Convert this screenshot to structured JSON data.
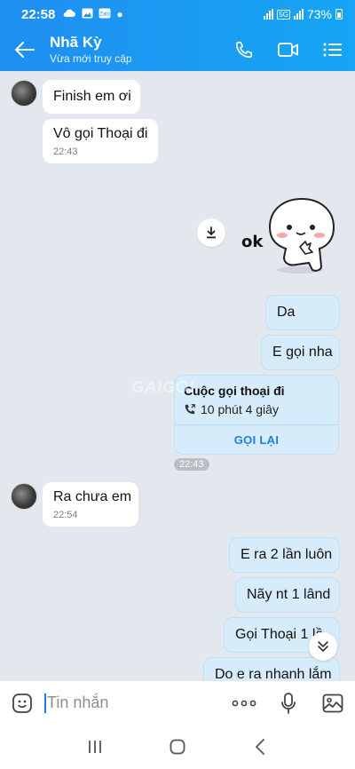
{
  "status_bar": {
    "time": "22:58",
    "network": "5G",
    "battery": "73%"
  },
  "header": {
    "contact_name": "Nhã Kỳ",
    "status": "Vừa mới truy cập"
  },
  "messages": {
    "m1": "Finish em ơi",
    "m2": "Vô gọi Thoại đi",
    "m2_time": "22:43",
    "sticker_text": "ok",
    "m3": "Da",
    "m4": "E gọi nha",
    "call_title": "Cuộc gọi thoại đi",
    "call_duration": "10 phút 4 giây",
    "call_again": "GỌI LẠI",
    "time_sep": "22:43",
    "m5": "Ra chưa em",
    "m5_time": "22:54",
    "m6": "E ra 2 lần luôn",
    "m7": "Nãy nt 1 lând",
    "m8": "Gọi Thoại 1 lầ",
    "m9": "Do e ra nhanh lắm"
  },
  "watermark": "GAIGOI",
  "input": {
    "placeholder": "Tin nhắn"
  },
  "colors": {
    "header_blue": "#1f8ef1",
    "outgoing_bubble": "#d7ecfb",
    "incoming_bubble": "#ffffff",
    "chat_bg": "#e3e8ee",
    "link_blue": "#1a7ee0"
  },
  "icons": [
    "back-arrow-icon",
    "phone-icon",
    "video-call-icon",
    "menu-list-icon",
    "download-icon",
    "phone-outgoing-icon",
    "chevron-double-down-icon",
    "emoji-icon",
    "more-dots-icon",
    "microphone-icon",
    "image-icon",
    "recents-icon",
    "home-icon",
    "back-nav-icon"
  ]
}
